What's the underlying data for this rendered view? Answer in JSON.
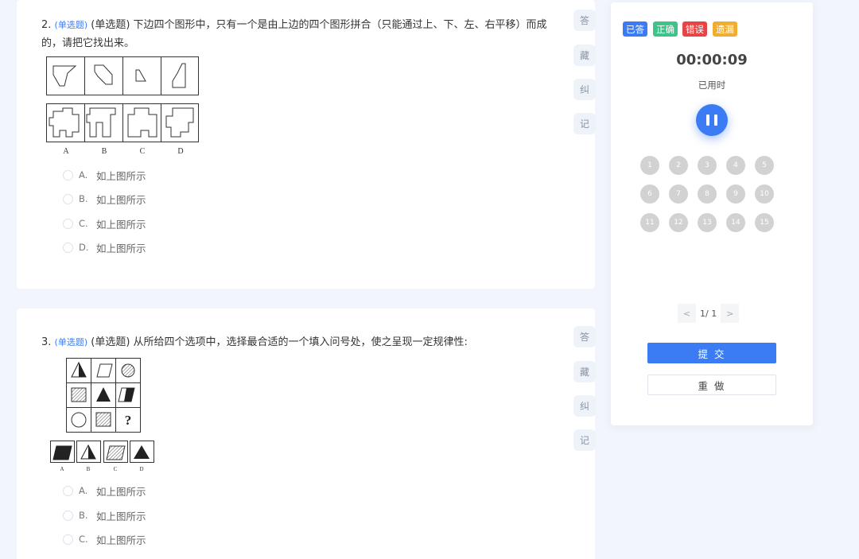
{
  "questions": [
    {
      "number": "2.",
      "type_tag": "(单选题)",
      "text": "(单选题) 下边四个图形中，只有一个是由上边的四个图形拼合（只能通过上、下、左、右平移）而成的，请把它找出来。",
      "figure_labels": [
        "A",
        "B",
        "C",
        "D"
      ],
      "options": [
        {
          "letter": "A.",
          "text": "如上图所示"
        },
        {
          "letter": "B.",
          "text": "如上图所示"
        },
        {
          "letter": "C.",
          "text": "如上图所示"
        },
        {
          "letter": "D.",
          "text": "如上图所示"
        }
      ],
      "side_buttons": [
        "答",
        "藏",
        "纠",
        "记"
      ]
    },
    {
      "number": "3.",
      "type_tag": "(单选题)",
      "text": "(单选题) 从所给四个选项中，选择最合适的一个填入问号处，使之呈现一定规律性:",
      "question_mark": "?",
      "figure_labels": [
        "A",
        "B",
        "C",
        "D"
      ],
      "options": [
        {
          "letter": "A.",
          "text": "如上图所示"
        },
        {
          "letter": "B.",
          "text": "如上图所示"
        },
        {
          "letter": "C.",
          "text": "如上图所示"
        }
      ],
      "side_buttons": [
        "答",
        "藏",
        "纠",
        "记"
      ]
    }
  ],
  "panel": {
    "legend": [
      {
        "label": "已答",
        "color": "#3b7cf5"
      },
      {
        "label": "正确",
        "color": "#3ec48a"
      },
      {
        "label": "错误",
        "color": "#ea4343"
      },
      {
        "label": "遗漏",
        "color": "#f0ad2f"
      }
    ],
    "timer": "00:00:09",
    "timer_label": "已用时",
    "question_numbers": [
      "1",
      "2",
      "3",
      "4",
      "5",
      "6",
      "7",
      "8",
      "9",
      "10",
      "11",
      "12",
      "13",
      "14",
      "15"
    ],
    "pager": {
      "prev": "<",
      "text": "1/ 1",
      "next": ">"
    },
    "submit_label": "提 交",
    "redo_label": "重 做"
  }
}
